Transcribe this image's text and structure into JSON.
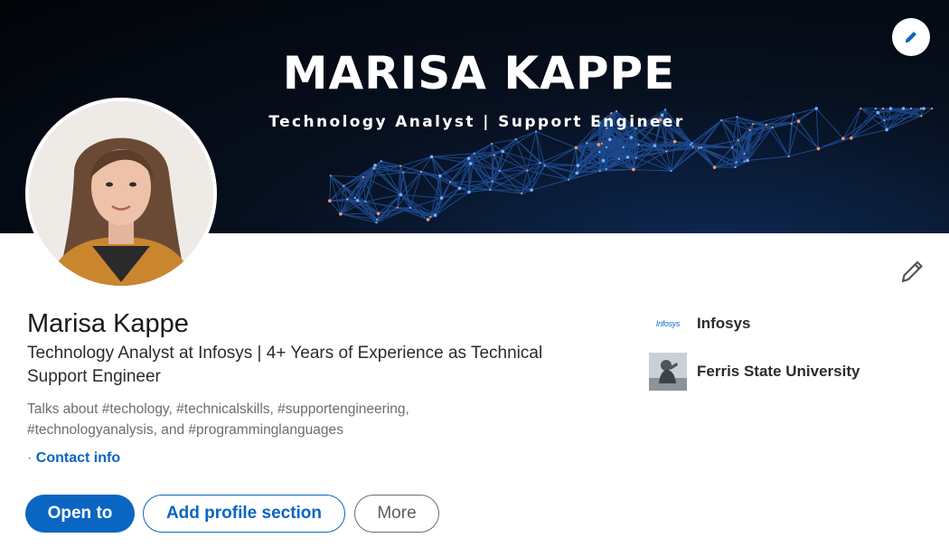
{
  "banner": {
    "name": "MARISA KAPPE",
    "tagline": "Technology Analyst | Support Engineer",
    "edit_icon": "pencil-icon"
  },
  "profile": {
    "name": "Marisa Kappe",
    "headline": "Technology Analyst at Infosys | 4+ Years of Experience as Technical Support Engineer",
    "talks_about": "Talks about #techology, #technicalskills, #supportengineering, #technologyanalysis, and #programminglanguages",
    "contact_prefix": "·",
    "contact_label": "Contact info",
    "edit_icon": "pencil-icon"
  },
  "actions": {
    "open_to": "Open to",
    "add_section": "Add profile section",
    "more": "More"
  },
  "experience": [
    {
      "logo_text": "Infosys",
      "name": "Infosys"
    },
    {
      "logo_text": "",
      "name": "Ferris State University"
    }
  ],
  "colors": {
    "accent": "#0a66c2",
    "text": "#191919",
    "muted": "#6d6d6d"
  }
}
